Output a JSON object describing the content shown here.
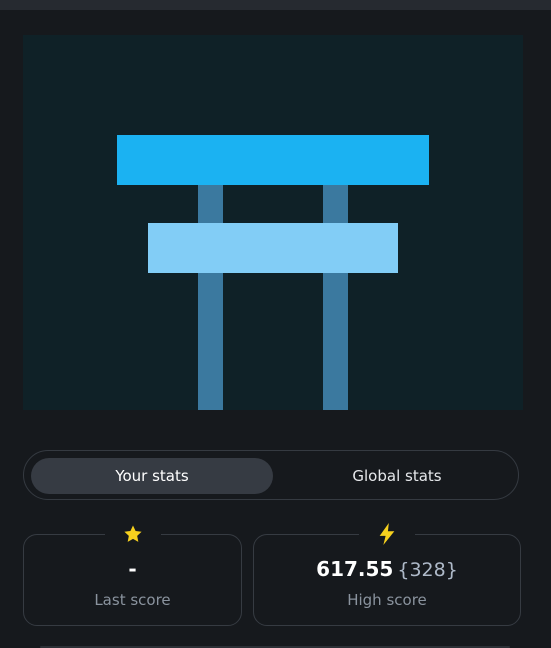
{
  "colors": {
    "background": "#16191d",
    "canvas": "#0f2127",
    "top_beam": "#1bb2f2",
    "lower_beam": "#82cdf6",
    "pillars": "#3b799f",
    "star": "#f7d11e",
    "bolt": "#f7d11e"
  },
  "tabs": [
    {
      "label": "Your stats",
      "active": true
    },
    {
      "label": "Global stats",
      "active": false
    }
  ],
  "last_score": {
    "icon": "star-icon",
    "value": "-",
    "label": "Last score"
  },
  "high_score": {
    "icon": "lightning-icon",
    "value": "617.55",
    "count": "{328}",
    "label": "High score"
  }
}
